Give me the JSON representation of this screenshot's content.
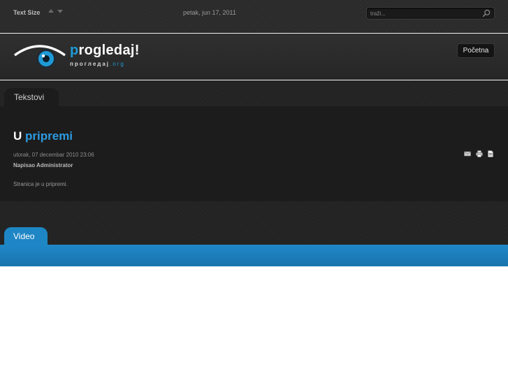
{
  "topbar": {
    "text_size_label": "Text Size",
    "date": "petak, jun 17, 2011",
    "search_placeholder": "traži..."
  },
  "header": {
    "logo_title_first": "p",
    "logo_title_rest": "rogledaj!",
    "logo_sub_main": "проглeдaj",
    "logo_sub_org": ".org",
    "home_label": "Početna"
  },
  "sections": {
    "tekstovi_tab": "Tekstovi",
    "video_tab": "Video"
  },
  "article": {
    "title_prefix": "U",
    "title_highlight": "pripremi",
    "date": "utorak, 07 decembar 2010 23:06",
    "author": "Napisao Administrator",
    "body": "Stranica je u pripremi."
  },
  "colors": {
    "accent": "#1e9ad6",
    "video_band": "#1e86c4",
    "dark_bg": "#1c1c1c"
  },
  "icons": [
    "search-icon",
    "email-icon",
    "print-icon",
    "pdf-icon",
    "eye-logo-icon"
  ]
}
